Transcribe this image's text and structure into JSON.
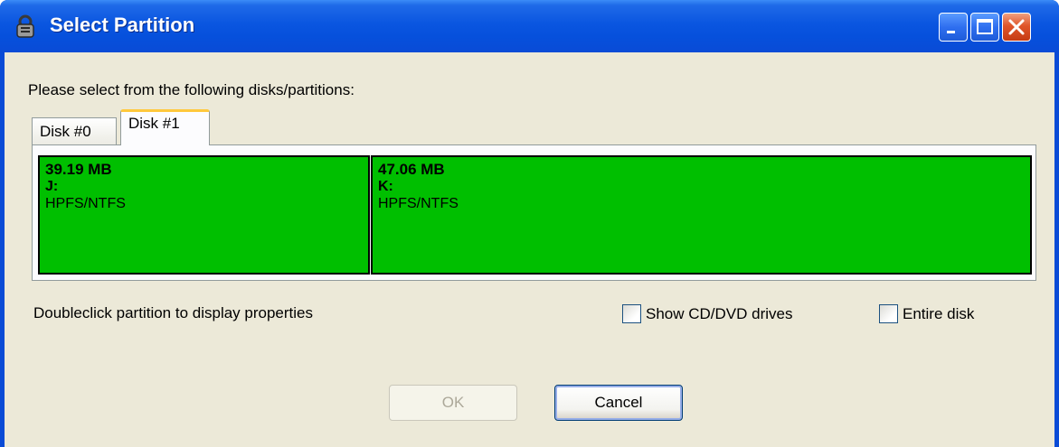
{
  "window": {
    "title": "Select Partition",
    "icon": "lock-icon"
  },
  "prompt": "Please select from the following disks/partitions:",
  "tabs": [
    {
      "label": "Disk #0",
      "selected": false
    },
    {
      "label": "Disk #1",
      "selected": true
    }
  ],
  "partitions": [
    {
      "size": "39.19 MB",
      "letter": "J:",
      "filesystem": "HPFS/NTFS",
      "color": "#00bf00"
    },
    {
      "size": "47.06 MB",
      "letter": "K:",
      "filesystem": "HPFS/NTFS",
      "color": "#00bf00"
    }
  ],
  "hint": "Doubleclick partition to display properties",
  "options": {
    "show_cd_dvd": {
      "label": "Show CD/DVD drives",
      "checked": false
    },
    "entire_disk": {
      "label": "Entire disk",
      "checked": false
    }
  },
  "buttons": {
    "ok": {
      "label": "OK",
      "enabled": false
    },
    "cancel": {
      "label": "Cancel",
      "enabled": true
    }
  },
  "colors": {
    "titlebar": "#0a56e0",
    "client_bg": "#ece9d8",
    "partition_fill": "#00bf00",
    "selected_tab_accent": "#ffc83c"
  }
}
